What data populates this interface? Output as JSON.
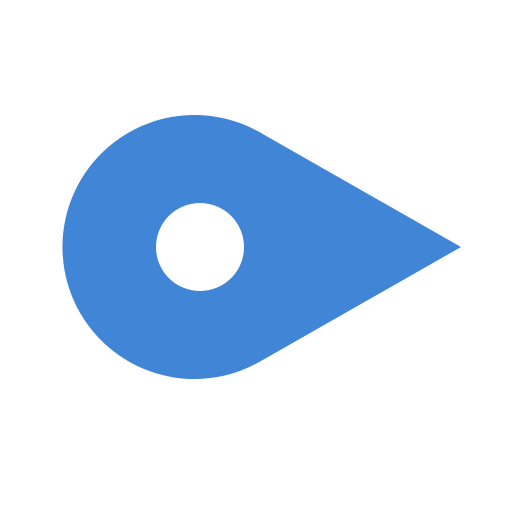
{
  "icon": {
    "name": "location-pin-icon",
    "color": "#4186D6",
    "hole_color": "#FFFFFF",
    "background": "#FFFFFF"
  }
}
